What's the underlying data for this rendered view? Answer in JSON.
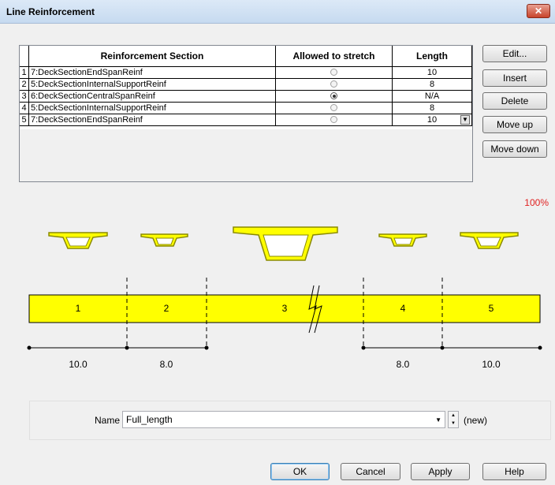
{
  "window": {
    "title": "Line Reinforcement",
    "close_glyph": "✕"
  },
  "table": {
    "columns": [
      "Reinforcement Section",
      "Allowed to stretch",
      "Length"
    ],
    "rows": [
      {
        "num": "1",
        "section": "7:DeckSectionEndSpanReinf",
        "stretch": false,
        "length": "10"
      },
      {
        "num": "2",
        "section": "5:DeckSectionInternalSupportReinf",
        "stretch": false,
        "length": "8"
      },
      {
        "num": "3",
        "section": "6:DeckSectionCentralSpanReinf",
        "stretch": true,
        "length": "N/A"
      },
      {
        "num": "4",
        "section": "5:DeckSectionInternalSupportReinf",
        "stretch": false,
        "length": "8"
      },
      {
        "num": "5",
        "section": "7:DeckSectionEndSpanReinf",
        "stretch": false,
        "length": "10"
      }
    ]
  },
  "side_buttons": {
    "edit": "Edit...",
    "insert": "Insert",
    "delete": "Delete",
    "move_up": "Move up",
    "move_down": "Move down"
  },
  "zoom": "100%",
  "diagram": {
    "segment_labels": [
      "1",
      "2",
      "3",
      "4",
      "5"
    ],
    "dimension_labels": [
      "10.0",
      "8.0",
      "8.0",
      "10.0"
    ],
    "fill_color": "#ffff00",
    "stroke_color": "#8a8a00"
  },
  "name_field": {
    "label": "Name",
    "value": "Full_length",
    "status": "(new)"
  },
  "bottom_buttons": {
    "ok": "OK",
    "cancel": "Cancel",
    "apply": "Apply",
    "help": "Help"
  }
}
